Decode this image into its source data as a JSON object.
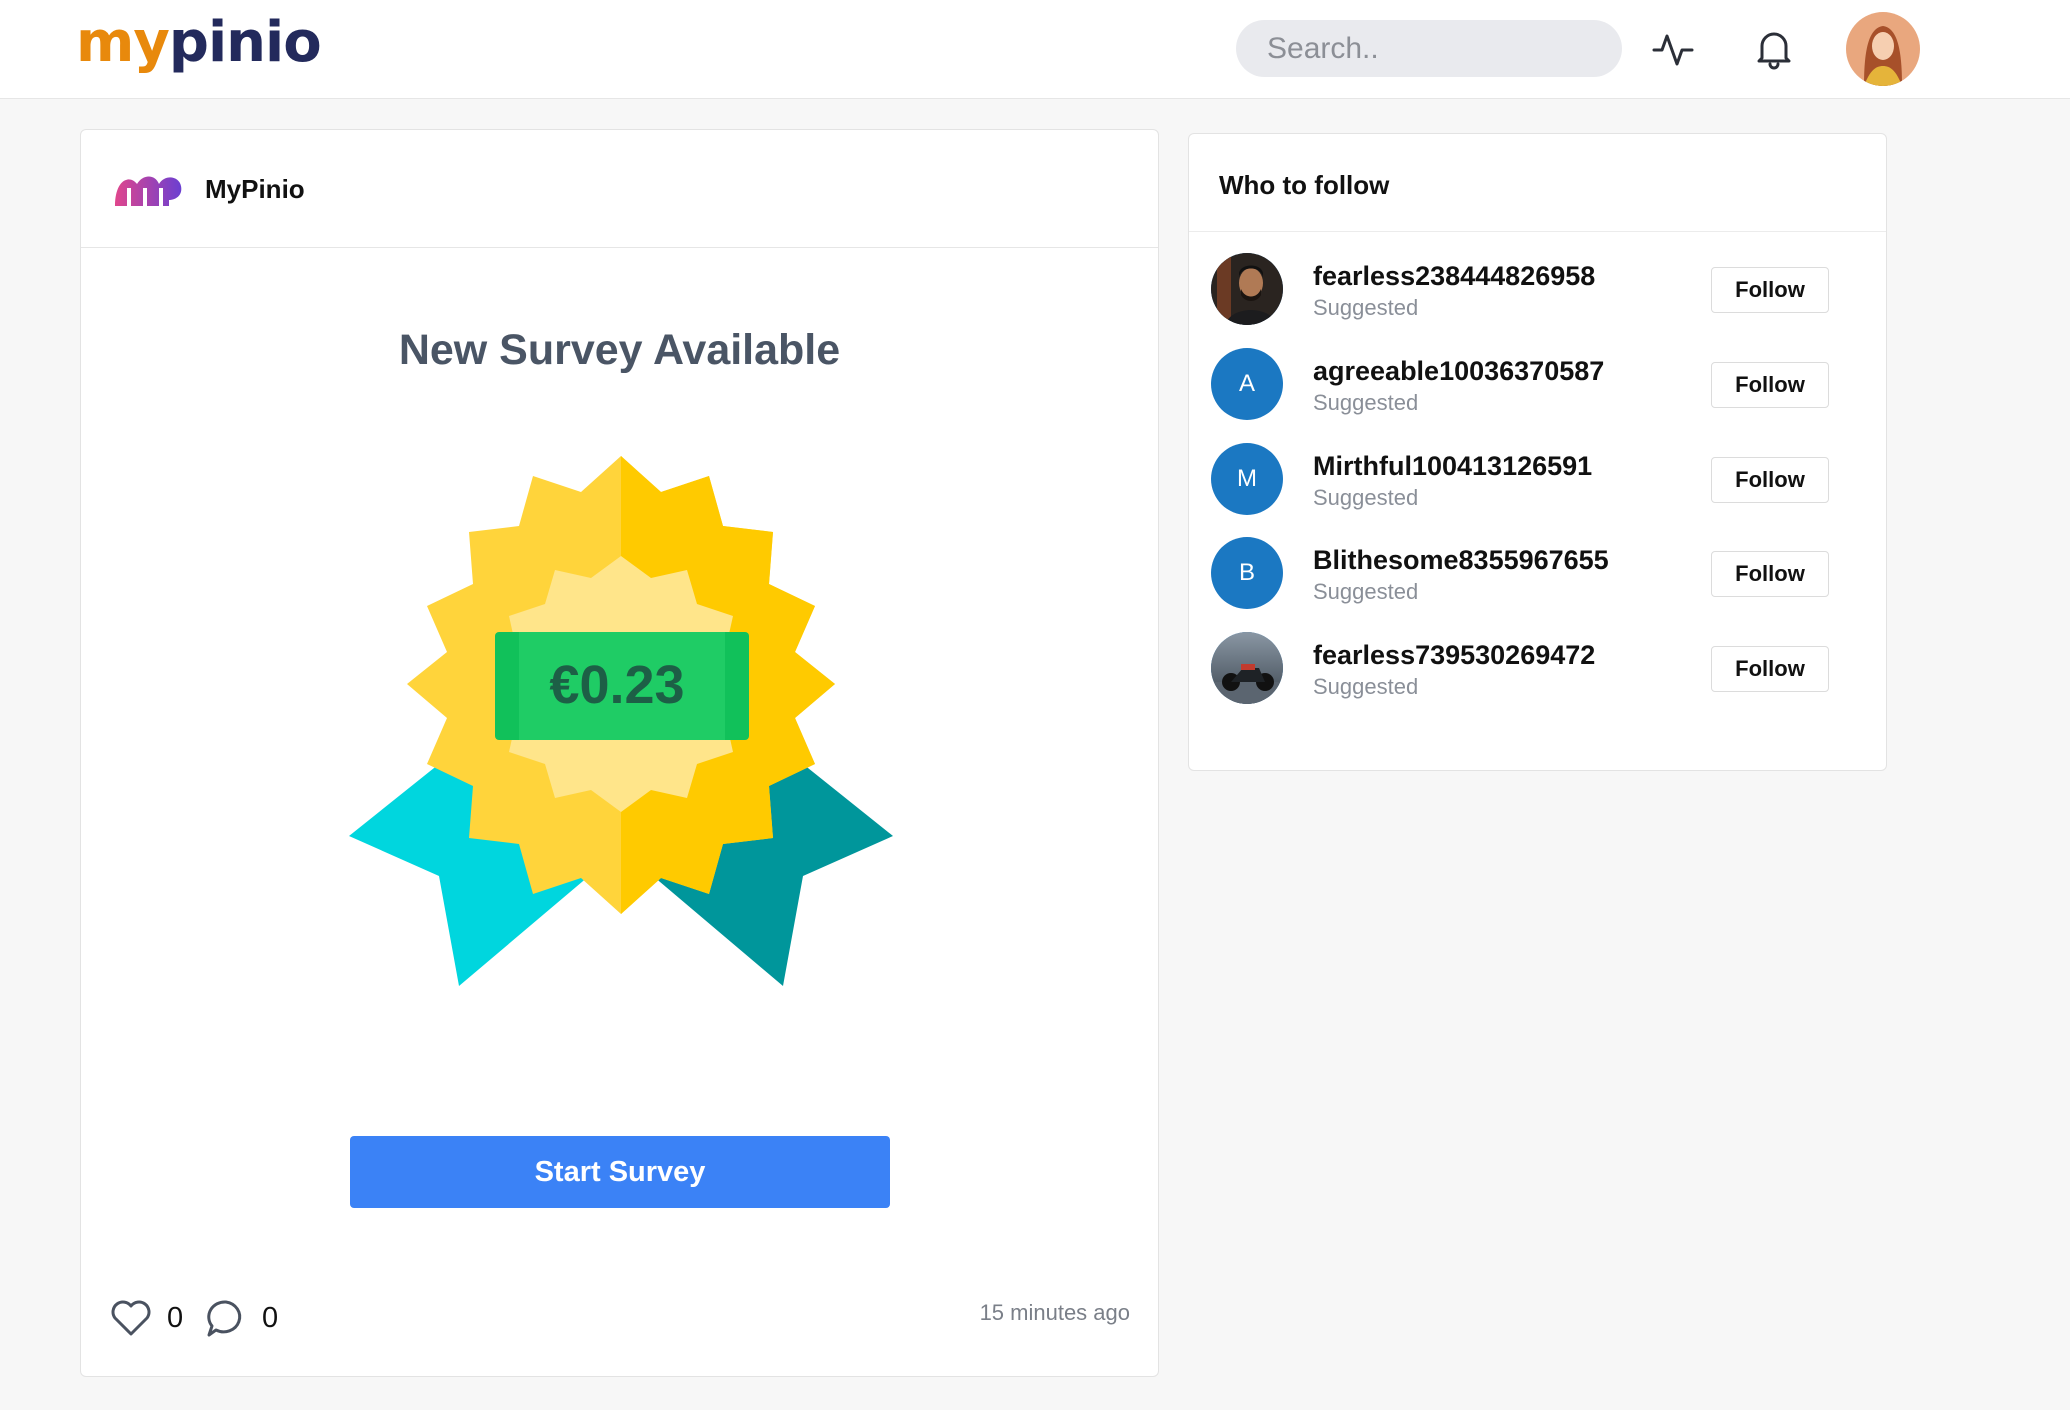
{
  "topbar": {
    "logo_part1": "my",
    "logo_part2": "pinio",
    "search_placeholder": "Search..",
    "activity_icon": "activity-icon",
    "bell_icon": "bell-icon"
  },
  "post": {
    "author": "MyPinio",
    "title": "New Survey Available",
    "reward": "€0.23",
    "button_label": "Start Survey",
    "likes": "0",
    "comments": "0",
    "time": "15 minutes ago"
  },
  "who_to_follow": {
    "title": "Who to follow",
    "follow_label": "Follow",
    "users": [
      {
        "name": "fearless238444826958",
        "subtitle": "Suggested",
        "initial": ""
      },
      {
        "name": "agreeable10036370587",
        "subtitle": "Suggested",
        "initial": "A"
      },
      {
        "name": "Mirthful100413126591",
        "subtitle": "Suggested",
        "initial": "M"
      },
      {
        "name": "Blithesome8355967655",
        "subtitle": "Suggested",
        "initial": "B"
      },
      {
        "name": "fearless739530269472",
        "subtitle": "Suggested",
        "initial": ""
      }
    ]
  },
  "colors": {
    "brand_orange": "#e8890c",
    "brand_navy": "#232a5c",
    "primary_button": "#3b82f6",
    "avatar_blue": "#1b78c2"
  }
}
